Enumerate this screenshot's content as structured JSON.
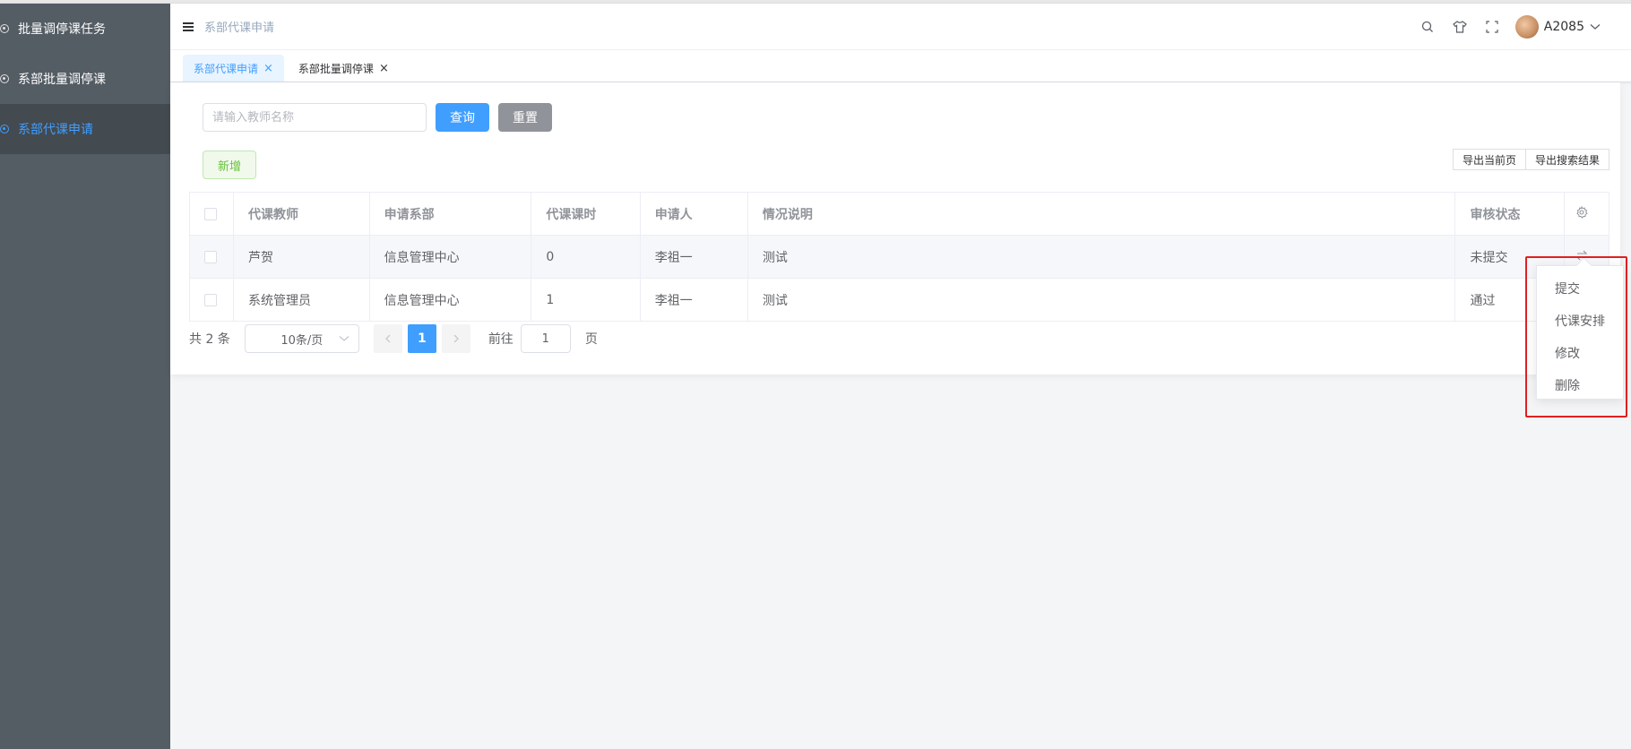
{
  "sidebar": {
    "items": [
      {
        "label": "批量调停课任务",
        "active": false
      },
      {
        "label": "系部批量调停课",
        "active": false
      },
      {
        "label": "系部代课申请",
        "active": true
      }
    ]
  },
  "navbar": {
    "breadcrumb": "系部代课申请",
    "user_name": "A2085"
  },
  "tags": [
    {
      "label": "系部代课申请",
      "active": true,
      "close": "×"
    },
    {
      "label": "系部批量调停课",
      "active": false,
      "close": "×"
    }
  ],
  "search": {
    "placeholder": "请输入教师名称",
    "value": "",
    "query_label": "查询",
    "reset_label": "重置"
  },
  "toolbar": {
    "add_label": "新增",
    "export_current": "导出当前页",
    "export_search": "导出搜索结果"
  },
  "table": {
    "columns": [
      "代课教师",
      "申请系部",
      "代课课时",
      "申请人",
      "情况说明",
      "审核状态"
    ],
    "rows": [
      [
        "芦贺",
        "信息管理中心",
        "0",
        "李祖一",
        "测试",
        "未提交"
      ],
      [
        "系统管理员",
        "信息管理中心",
        "1",
        "李祖一",
        "测试",
        "通过"
      ]
    ]
  },
  "pagination": {
    "total_text": "共 2 条",
    "page_size": "10条/页",
    "current_page": "1",
    "goto_label": "前往",
    "goto_value": "1",
    "page_suffix": "页"
  },
  "dropdown": {
    "items": [
      "提交",
      "代课安排",
      "修改",
      "删除"
    ]
  },
  "colors": {
    "primary": "#409eff",
    "sidebar_bg": "#545c64",
    "success": "#67c23a",
    "highlight": "#e02020"
  }
}
